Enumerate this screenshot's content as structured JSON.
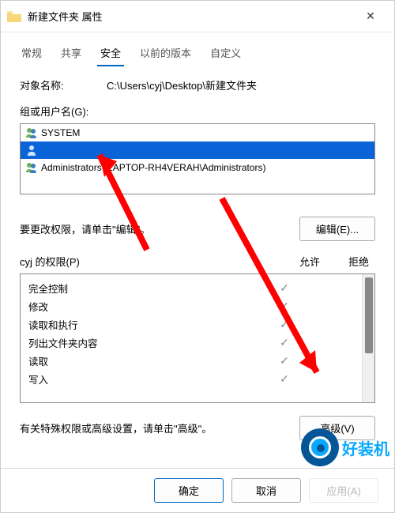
{
  "titlebar": {
    "title": "新建文件夹 属性"
  },
  "tabs": [
    {
      "label": "常规"
    },
    {
      "label": "共享"
    },
    {
      "label": "安全"
    },
    {
      "label": "以前的版本"
    },
    {
      "label": "自定义"
    }
  ],
  "object": {
    "label": "对象名称:",
    "path": "C:\\Users\\cyj\\Desktop\\新建文件夹"
  },
  "groups": {
    "label": "组或用户名(G):",
    "items": [
      {
        "name": "SYSTEM",
        "selected": false
      },
      {
        "name": "",
        "selected": true
      },
      {
        "name": "Administrators (LAPTOP-RH4VERAH\\Administrators)",
        "selected": false
      }
    ]
  },
  "edit": {
    "hint": "要更改权限，请单击\"编辑\"。",
    "btn": "编辑(E)..."
  },
  "perm": {
    "title": "cyj 的权限(P)",
    "col_allow": "允许",
    "col_deny": "拒绝",
    "rows": [
      {
        "name": "完全控制",
        "allow": true
      },
      {
        "name": "修改",
        "allow": true
      },
      {
        "name": "读取和执行",
        "allow": true
      },
      {
        "name": "列出文件夹内容",
        "allow": true
      },
      {
        "name": "读取",
        "allow": true
      },
      {
        "name": "写入",
        "allow": true
      }
    ]
  },
  "adv": {
    "hint": "有关特殊权限或高级设置，请单击\"高级\"。",
    "btn": "高级(V)"
  },
  "footer": {
    "ok": "确定",
    "cancel": "取消",
    "apply": "应用(A)"
  },
  "watermark": {
    "text": "好装机"
  }
}
